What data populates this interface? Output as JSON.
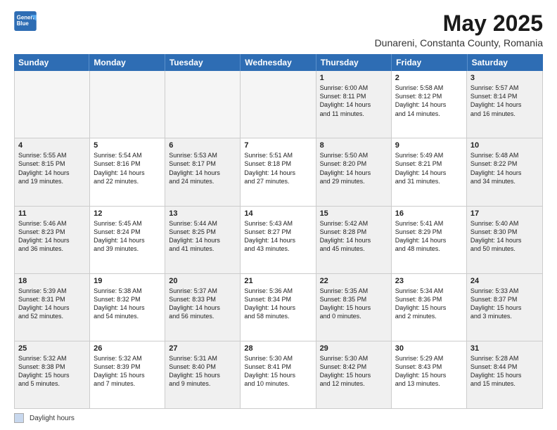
{
  "logo": {
    "line1": "General",
    "line2": "Blue"
  },
  "title": "May 2025",
  "subtitle": "Dunareni, Constanta County, Romania",
  "header_days": [
    "Sunday",
    "Monday",
    "Tuesday",
    "Wednesday",
    "Thursday",
    "Friday",
    "Saturday"
  ],
  "weeks": [
    [
      {
        "day": "",
        "info": [],
        "empty": true
      },
      {
        "day": "",
        "info": [],
        "empty": true
      },
      {
        "day": "",
        "info": [],
        "empty": true
      },
      {
        "day": "",
        "info": [],
        "empty": true
      },
      {
        "day": "1",
        "info": [
          "Sunrise: 6:00 AM",
          "Sunset: 8:11 PM",
          "Daylight: 14 hours",
          "and 11 minutes."
        ],
        "empty": false
      },
      {
        "day": "2",
        "info": [
          "Sunrise: 5:58 AM",
          "Sunset: 8:12 PM",
          "Daylight: 14 hours",
          "and 14 minutes."
        ],
        "empty": false
      },
      {
        "day": "3",
        "info": [
          "Sunrise: 5:57 AM",
          "Sunset: 8:14 PM",
          "Daylight: 14 hours",
          "and 16 minutes."
        ],
        "empty": false
      }
    ],
    [
      {
        "day": "4",
        "info": [
          "Sunrise: 5:55 AM",
          "Sunset: 8:15 PM",
          "Daylight: 14 hours",
          "and 19 minutes."
        ],
        "empty": false
      },
      {
        "day": "5",
        "info": [
          "Sunrise: 5:54 AM",
          "Sunset: 8:16 PM",
          "Daylight: 14 hours",
          "and 22 minutes."
        ],
        "empty": false
      },
      {
        "day": "6",
        "info": [
          "Sunrise: 5:53 AM",
          "Sunset: 8:17 PM",
          "Daylight: 14 hours",
          "and 24 minutes."
        ],
        "empty": false
      },
      {
        "day": "7",
        "info": [
          "Sunrise: 5:51 AM",
          "Sunset: 8:18 PM",
          "Daylight: 14 hours",
          "and 27 minutes."
        ],
        "empty": false
      },
      {
        "day": "8",
        "info": [
          "Sunrise: 5:50 AM",
          "Sunset: 8:20 PM",
          "Daylight: 14 hours",
          "and 29 minutes."
        ],
        "empty": false
      },
      {
        "day": "9",
        "info": [
          "Sunrise: 5:49 AM",
          "Sunset: 8:21 PM",
          "Daylight: 14 hours",
          "and 31 minutes."
        ],
        "empty": false
      },
      {
        "day": "10",
        "info": [
          "Sunrise: 5:48 AM",
          "Sunset: 8:22 PM",
          "Daylight: 14 hours",
          "and 34 minutes."
        ],
        "empty": false
      }
    ],
    [
      {
        "day": "11",
        "info": [
          "Sunrise: 5:46 AM",
          "Sunset: 8:23 PM",
          "Daylight: 14 hours",
          "and 36 minutes."
        ],
        "empty": false
      },
      {
        "day": "12",
        "info": [
          "Sunrise: 5:45 AM",
          "Sunset: 8:24 PM",
          "Daylight: 14 hours",
          "and 39 minutes."
        ],
        "empty": false
      },
      {
        "day": "13",
        "info": [
          "Sunrise: 5:44 AM",
          "Sunset: 8:25 PM",
          "Daylight: 14 hours",
          "and 41 minutes."
        ],
        "empty": false
      },
      {
        "day": "14",
        "info": [
          "Sunrise: 5:43 AM",
          "Sunset: 8:27 PM",
          "Daylight: 14 hours",
          "and 43 minutes."
        ],
        "empty": false
      },
      {
        "day": "15",
        "info": [
          "Sunrise: 5:42 AM",
          "Sunset: 8:28 PM",
          "Daylight: 14 hours",
          "and 45 minutes."
        ],
        "empty": false
      },
      {
        "day": "16",
        "info": [
          "Sunrise: 5:41 AM",
          "Sunset: 8:29 PM",
          "Daylight: 14 hours",
          "and 48 minutes."
        ],
        "empty": false
      },
      {
        "day": "17",
        "info": [
          "Sunrise: 5:40 AM",
          "Sunset: 8:30 PM",
          "Daylight: 14 hours",
          "and 50 minutes."
        ],
        "empty": false
      }
    ],
    [
      {
        "day": "18",
        "info": [
          "Sunrise: 5:39 AM",
          "Sunset: 8:31 PM",
          "Daylight: 14 hours",
          "and 52 minutes."
        ],
        "empty": false
      },
      {
        "day": "19",
        "info": [
          "Sunrise: 5:38 AM",
          "Sunset: 8:32 PM",
          "Daylight: 14 hours",
          "and 54 minutes."
        ],
        "empty": false
      },
      {
        "day": "20",
        "info": [
          "Sunrise: 5:37 AM",
          "Sunset: 8:33 PM",
          "Daylight: 14 hours",
          "and 56 minutes."
        ],
        "empty": false
      },
      {
        "day": "21",
        "info": [
          "Sunrise: 5:36 AM",
          "Sunset: 8:34 PM",
          "Daylight: 14 hours",
          "and 58 minutes."
        ],
        "empty": false
      },
      {
        "day": "22",
        "info": [
          "Sunrise: 5:35 AM",
          "Sunset: 8:35 PM",
          "Daylight: 15 hours",
          "and 0 minutes."
        ],
        "empty": false
      },
      {
        "day": "23",
        "info": [
          "Sunrise: 5:34 AM",
          "Sunset: 8:36 PM",
          "Daylight: 15 hours",
          "and 2 minutes."
        ],
        "empty": false
      },
      {
        "day": "24",
        "info": [
          "Sunrise: 5:33 AM",
          "Sunset: 8:37 PM",
          "Daylight: 15 hours",
          "and 3 minutes."
        ],
        "empty": false
      }
    ],
    [
      {
        "day": "25",
        "info": [
          "Sunrise: 5:32 AM",
          "Sunset: 8:38 PM",
          "Daylight: 15 hours",
          "and 5 minutes."
        ],
        "empty": false
      },
      {
        "day": "26",
        "info": [
          "Sunrise: 5:32 AM",
          "Sunset: 8:39 PM",
          "Daylight: 15 hours",
          "and 7 minutes."
        ],
        "empty": false
      },
      {
        "day": "27",
        "info": [
          "Sunrise: 5:31 AM",
          "Sunset: 8:40 PM",
          "Daylight: 15 hours",
          "and 9 minutes."
        ],
        "empty": false
      },
      {
        "day": "28",
        "info": [
          "Sunrise: 5:30 AM",
          "Sunset: 8:41 PM",
          "Daylight: 15 hours",
          "and 10 minutes."
        ],
        "empty": false
      },
      {
        "day": "29",
        "info": [
          "Sunrise: 5:30 AM",
          "Sunset: 8:42 PM",
          "Daylight: 15 hours",
          "and 12 minutes."
        ],
        "empty": false
      },
      {
        "day": "30",
        "info": [
          "Sunrise: 5:29 AM",
          "Sunset: 8:43 PM",
          "Daylight: 15 hours",
          "and 13 minutes."
        ],
        "empty": false
      },
      {
        "day": "31",
        "info": [
          "Sunrise: 5:28 AM",
          "Sunset: 8:44 PM",
          "Daylight: 15 hours",
          "and 15 minutes."
        ],
        "empty": false
      }
    ]
  ],
  "footer": {
    "legend_label": "Daylight hours"
  }
}
